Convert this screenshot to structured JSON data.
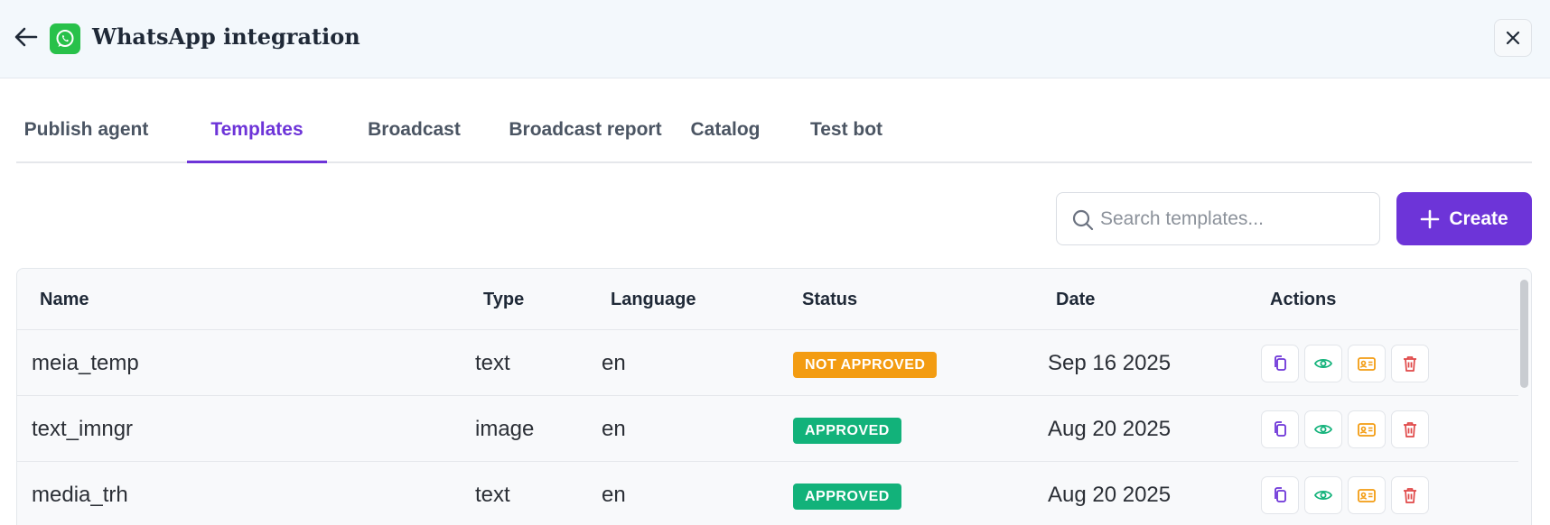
{
  "header": {
    "title": "WhatsApp integration"
  },
  "tabs": [
    {
      "label": "Publish agent"
    },
    {
      "label": "Templates"
    },
    {
      "label": "Broadcast"
    },
    {
      "label": "Broadcast report"
    },
    {
      "label": "Catalog"
    },
    {
      "label": "Test bot"
    }
  ],
  "active_tab": "Templates",
  "search": {
    "placeholder": "Search templates...",
    "value": ""
  },
  "create_button": {
    "label": "Create"
  },
  "table": {
    "columns": [
      "Name",
      "Type",
      "Language",
      "Status",
      "Date",
      "Actions"
    ],
    "rows": [
      {
        "name": "meia_temp",
        "type": "text",
        "language": "en",
        "status": "NOT APPROVED",
        "date": "Sep 16 2025"
      },
      {
        "name": "text_imngr",
        "type": "image",
        "language": "en",
        "status": "APPROVED",
        "date": "Aug 20 2025"
      },
      {
        "name": "media_trh",
        "type": "text",
        "language": "en",
        "status": "APPROVED",
        "date": "Aug 20 2025"
      }
    ]
  },
  "colors": {
    "accent": "#6d34d8",
    "whatsapp_green": "#28c14a",
    "status_not_approved": "#f39c12",
    "status_approved": "#12b27a",
    "action_copy": "#6d34d8",
    "action_view": "#12b27a",
    "action_card": "#f39c12",
    "action_delete": "#e04848"
  },
  "icons": {
    "back": "arrow-left-icon",
    "logo": "whatsapp-icon",
    "close": "close-icon",
    "search": "search-icon",
    "create": "plus-icon",
    "row_actions": [
      "copy-icon",
      "eye-icon",
      "id-card-icon",
      "trash-icon"
    ]
  }
}
